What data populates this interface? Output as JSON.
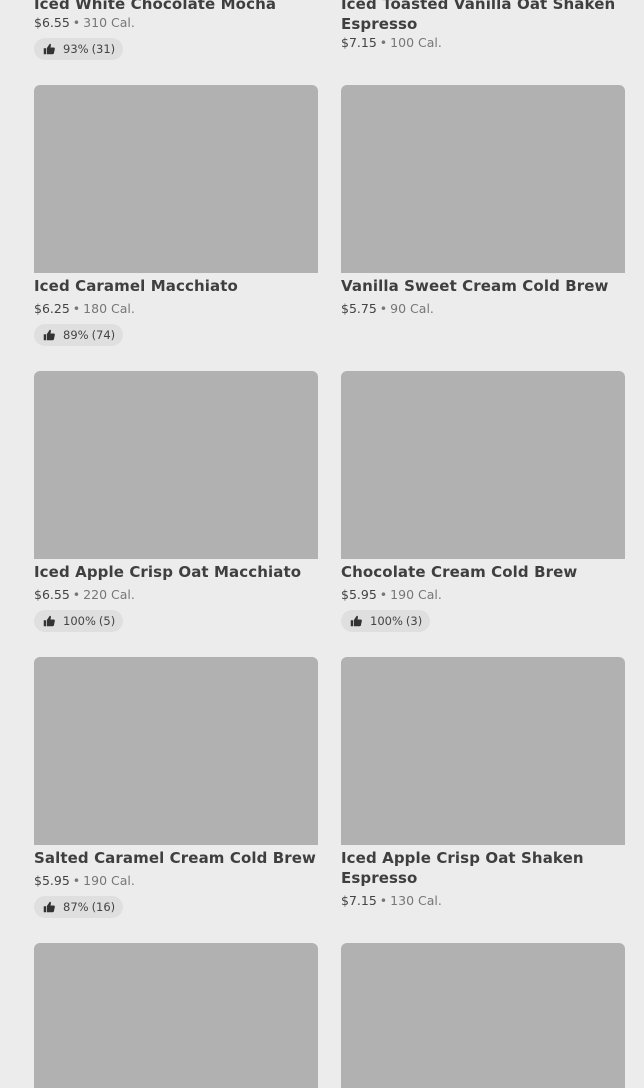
{
  "products": [
    {
      "name": "Iced White Chocolate Mocha",
      "price": "$6.55",
      "calories": "310 Cal.",
      "rating_percent": "93%",
      "rating_count": "(31)"
    },
    {
      "name": "Iced Toasted Vanilla Oat Shaken Espresso",
      "price": "$7.15",
      "calories": "100 Cal."
    },
    {
      "name": "Iced Caramel Macchiato",
      "price": "$6.25",
      "calories": "180 Cal.",
      "rating_percent": "89%",
      "rating_count": "(74)"
    },
    {
      "name": "Vanilla Sweet Cream Cold Brew",
      "price": "$5.75",
      "calories": "90 Cal."
    },
    {
      "name": "Iced Apple Crisp Oat Macchiato",
      "price": "$6.55",
      "calories": "220 Cal.",
      "rating_percent": "100%",
      "rating_count": "(5)"
    },
    {
      "name": "Chocolate Cream Cold Brew",
      "price": "$5.95",
      "calories": "190 Cal.",
      "rating_percent": "100%",
      "rating_count": "(3)"
    },
    {
      "name": "Salted Caramel Cream Cold Brew",
      "price": "$5.95",
      "calories": "190 Cal.",
      "rating_percent": "87%",
      "rating_count": "(16)"
    },
    {
      "name": "Iced Apple Crisp Oat Shaken Espresso",
      "price": "$7.15",
      "calories": "130 Cal."
    }
  ],
  "separator": "•",
  "icons": {
    "rating": "thumbs-up-icon"
  },
  "colors": {
    "background": "#ececec",
    "placeholder": "#b1b1b1",
    "pill": "#dfdfdf"
  }
}
